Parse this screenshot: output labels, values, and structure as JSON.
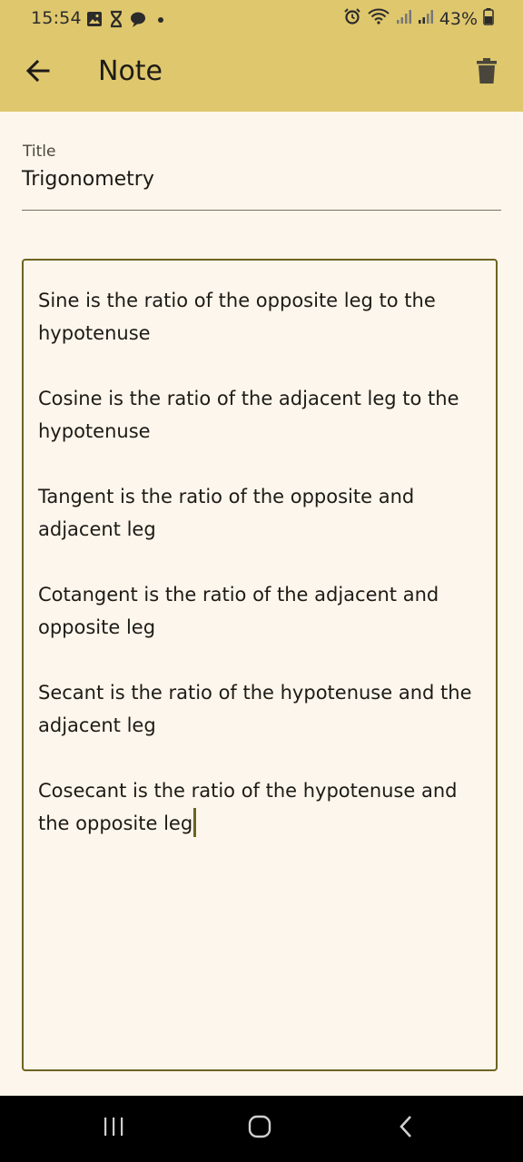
{
  "status_bar": {
    "time": "15:54",
    "battery": "43%",
    "icons": [
      "image-icon",
      "hourglass-icon",
      "chat-bubble-icon",
      "dot-icon",
      "alarm-icon",
      "wifi-icon",
      "signal-icon",
      "signal-icon",
      "battery-icon"
    ]
  },
  "toolbar": {
    "title": "Note",
    "back_icon": "arrow-back-icon",
    "delete_icon": "trash-icon"
  },
  "title_field": {
    "label": "Title",
    "value": "Trigonometry"
  },
  "content": {
    "text": "Sine is the ratio of the opposite leg to the hypotenuse\n\nCosine is the ratio of the adjacent leg to the hypotenuse\n\nTangent is the ratio of the opposite and adjacent leg\n\nCotangent is the ratio of the adjacent and opposite leg\n\nSecant is the ratio of the hypotenuse and the adjacent leg\n\nCosecant is the ratio of the hypotenuse and the opposite leg"
  },
  "colors": {
    "app_bar": "#DFC76E",
    "background": "#FDF6EC",
    "accent_border": "#6E6320",
    "nav_bar": "#000000"
  },
  "nav_bar": {
    "icons": [
      "recent-apps-icon",
      "home-icon",
      "back-icon"
    ]
  }
}
